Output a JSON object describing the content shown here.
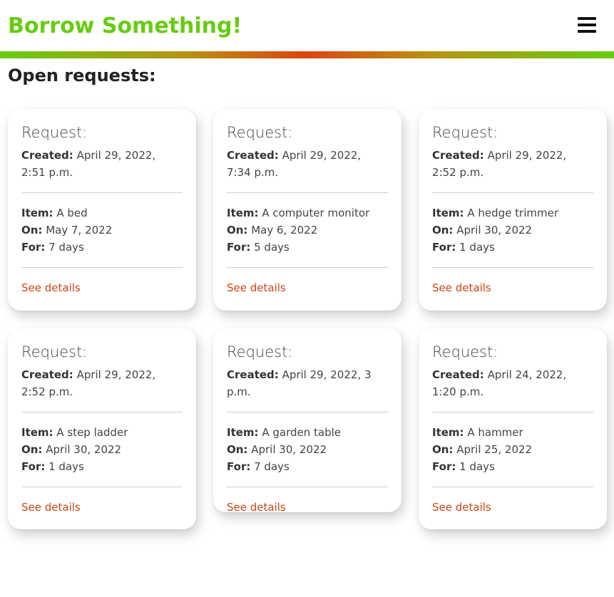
{
  "header": {
    "brand": "Borrow Something!",
    "menu_icon": "hamburger-menu-icon",
    "gradient_colors": [
      "#66cc11",
      "#dd4411",
      "#66cc11"
    ]
  },
  "page": {
    "title": "Open requests:"
  },
  "labels": {
    "card_title": "Request:",
    "created": "Created:",
    "item": "Item:",
    "on": "On:",
    "for": "For:",
    "details_link": "See details"
  },
  "requests": [
    {
      "created": "April 29, 2022, 2:51 p.m.",
      "item": "A bed",
      "on": "May 7, 2022",
      "for": "7 days"
    },
    {
      "created": "April 29, 2022, 7:34 p.m.",
      "item": "A computer monitor",
      "on": "May 6, 2022",
      "for": "5 days"
    },
    {
      "created": "April 29, 2022, 2:52 p.m.",
      "item": "A hedge trimmer",
      "on": "April 30, 2022",
      "for": "1 days"
    },
    {
      "created": "April 29, 2022, 2:52 p.m.",
      "item": "A step ladder",
      "on": "April 30, 2022",
      "for": "1 days"
    },
    {
      "created": "April 29, 2022, 3 p.m.",
      "item": "A garden table",
      "on": "April 30, 2022",
      "for": "7 days"
    },
    {
      "created": "April 24, 2022, 1:20 p.m.",
      "item": "A hammer",
      "on": "April 25, 2022",
      "for": "1 days"
    }
  ],
  "colors": {
    "brand": "#66cc11",
    "link": "#cc4411",
    "accent": "#dd4411"
  }
}
